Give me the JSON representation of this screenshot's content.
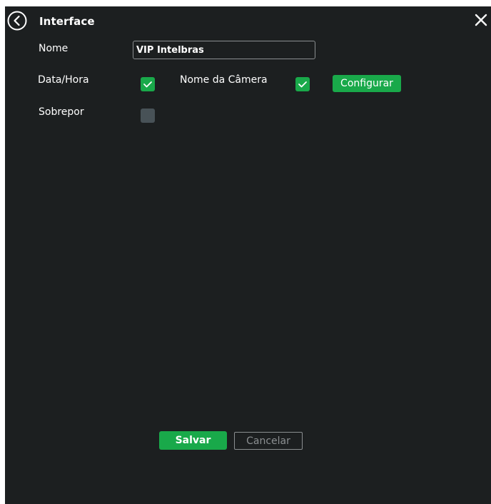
{
  "header": {
    "title": "Interface",
    "back_icon": "chevron-left-circle-icon",
    "close_icon": "close-icon"
  },
  "form": {
    "name_label": "Nome",
    "name_value": "VIP Intelbras",
    "datetime_label": "Data/Hora",
    "datetime_checked": true,
    "camera_name_label": "Nome da Câmera",
    "camera_name_checked": true,
    "configure_label": "Configurar",
    "overlay_label": "Sobrepor",
    "overlay_checked": false
  },
  "footer": {
    "save_label": "Salvar",
    "cancel_label": "Cancelar"
  },
  "colors": {
    "background": "#1c1f20",
    "accent": "#19a94a",
    "unchecked": "#485257",
    "muted": "#8b8f91"
  }
}
